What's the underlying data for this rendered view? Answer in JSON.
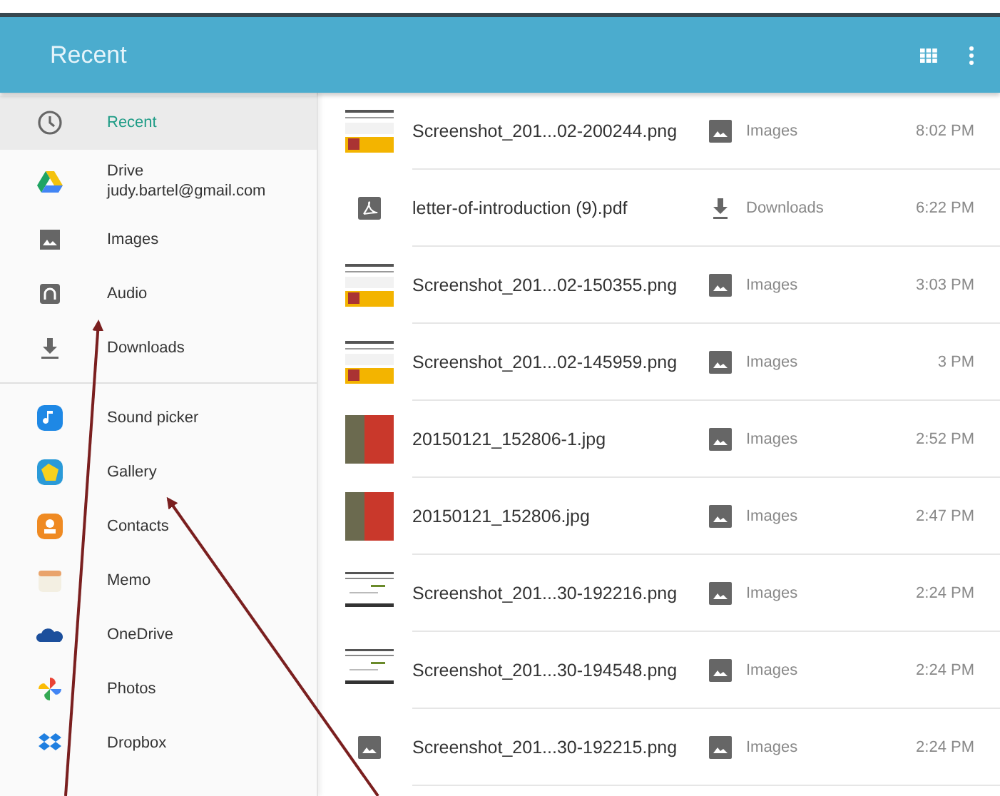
{
  "toolbar": {
    "title": "Recent"
  },
  "sidebar": {
    "items": [
      {
        "kind": "recent",
        "label": "Recent",
        "selected": true
      },
      {
        "kind": "drive",
        "label": "Drive",
        "sublabel": "judy.bartel@gmail.com",
        "selected": false
      },
      {
        "kind": "images",
        "label": "Images",
        "selected": false
      },
      {
        "kind": "audio",
        "label": "Audio",
        "selected": false
      },
      {
        "kind": "downloads",
        "label": "Downloads",
        "selected": false
      },
      {
        "kind": "divider"
      },
      {
        "kind": "soundpicker",
        "label": "Sound picker",
        "selected": false
      },
      {
        "kind": "gallery",
        "label": "Gallery",
        "selected": false
      },
      {
        "kind": "contacts",
        "label": "Contacts",
        "selected": false
      },
      {
        "kind": "memo",
        "label": "Memo",
        "selected": false
      },
      {
        "kind": "onedrive",
        "label": "OneDrive",
        "selected": false
      },
      {
        "kind": "photos",
        "label": "Photos",
        "selected": false
      },
      {
        "kind": "dropbox",
        "label": "Dropbox",
        "selected": false
      }
    ]
  },
  "files": [
    {
      "kind": "screenshot",
      "name": "Screenshot_201...02-200244.png",
      "location": {
        "kind": "images",
        "label": "Images"
      },
      "time": "8:02 PM"
    },
    {
      "kind": "pdf",
      "name": "letter-of-introduction (9).pdf",
      "location": {
        "kind": "downloads",
        "label": "Downloads"
      },
      "time": "6:22 PM"
    },
    {
      "kind": "screenshot",
      "name": "Screenshot_201...02-150355.png",
      "location": {
        "kind": "images",
        "label": "Images"
      },
      "time": "3:03 PM"
    },
    {
      "kind": "screenshot",
      "name": "Screenshot_201...02-145959.png",
      "location": {
        "kind": "images",
        "label": "Images"
      },
      "time": "3 PM"
    },
    {
      "kind": "photo",
      "name": "20150121_152806-1.jpg",
      "location": {
        "kind": "images",
        "label": "Images"
      },
      "time": "2:52 PM"
    },
    {
      "kind": "photo",
      "name": "20150121_152806.jpg",
      "location": {
        "kind": "images",
        "label": "Images"
      },
      "time": "2:47 PM"
    },
    {
      "kind": "document",
      "name": "Screenshot_201...30-192216.png",
      "location": {
        "kind": "images",
        "label": "Images"
      },
      "time": "2:24 PM"
    },
    {
      "kind": "document",
      "name": "Screenshot_201...30-194548.png",
      "location": {
        "kind": "images",
        "label": "Images"
      },
      "time": "2:24 PM"
    },
    {
      "kind": "image",
      "name": "Screenshot_201...30-192215.png",
      "location": {
        "kind": "images",
        "label": "Images"
      },
      "time": "2:24 PM"
    }
  ],
  "annotations": [
    {
      "kind": "arrow"
    },
    {
      "kind": "arrow"
    }
  ]
}
